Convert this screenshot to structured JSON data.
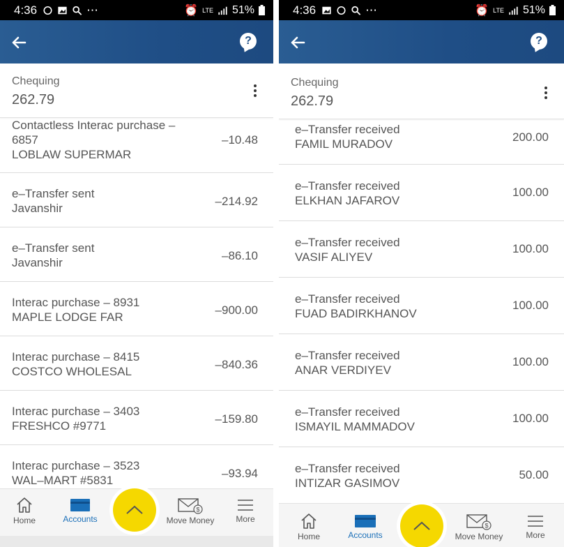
{
  "status_bar": {
    "left": {
      "time": "4:36"
    },
    "right": {
      "time": "4:36"
    },
    "network": "LTE",
    "battery": "51%"
  },
  "colors": {
    "appbar": "#1f4e86",
    "accent": "#1a6fb8",
    "fab": "#f5d800"
  },
  "account": {
    "name": "Chequing",
    "balance": "262.79"
  },
  "left_transactions": [
    {
      "line1": "Contactless Interac purchase –",
      "line2": "6857",
      "line3": "LOBLAW SUPERMAR",
      "amount": "–10.48"
    },
    {
      "line1": "e–Transfer sent",
      "line2": "Javanshir",
      "amount": "–214.92"
    },
    {
      "line1": "e–Transfer sent",
      "line2": "Javanshir",
      "amount": "–86.10"
    },
    {
      "line1": "Interac purchase – 8931",
      "line2": "MAPLE LODGE FAR",
      "amount": "–900.00"
    },
    {
      "line1": "Interac purchase – 8415",
      "line2": "COSTCO WHOLESAL",
      "amount": "–840.36"
    },
    {
      "line1": "Interac purchase – 3403",
      "line2": "FRESHCO #9771",
      "amount": "–159.80"
    },
    {
      "line1": "Interac purchase – 3523",
      "line2": "WAL–MART #5831",
      "amount": "–93.94"
    }
  ],
  "right_transactions": [
    {
      "line1": "e–Transfer received",
      "line2": "FAMIL MURADOV",
      "amount": "200.00"
    },
    {
      "line1": "e–Transfer received",
      "line2": "ELKHAN JAFAROV",
      "amount": "100.00"
    },
    {
      "line1": "e–Transfer received",
      "line2": "VASIF ALIYEV",
      "amount": "100.00"
    },
    {
      "line1": "e–Transfer received",
      "line2": "FUAD BADIRKHANOV",
      "amount": "100.00"
    },
    {
      "line1": "e–Transfer received",
      "line2": "ANAR VERDIYEV",
      "amount": "100.00"
    },
    {
      "line1": "e–Transfer received",
      "line2": "ISMAYIL MAMMADOV",
      "amount": "100.00"
    },
    {
      "line1": "e–Transfer received",
      "line2": "INTIZAR GASIMOV",
      "amount": "50.00"
    }
  ],
  "nav": {
    "home": "Home",
    "accounts": "Accounts",
    "move_money": "Move Money",
    "more": "More"
  },
  "icons": {
    "back": "arrow-left-icon",
    "help": "help-bubble-icon",
    "menu": "kebab-menu-icon",
    "home": "home-icon",
    "accounts": "card-icon",
    "fab": "chevron-up-icon",
    "move_money": "envelope-dollar-icon",
    "more": "hamburger-icon"
  }
}
